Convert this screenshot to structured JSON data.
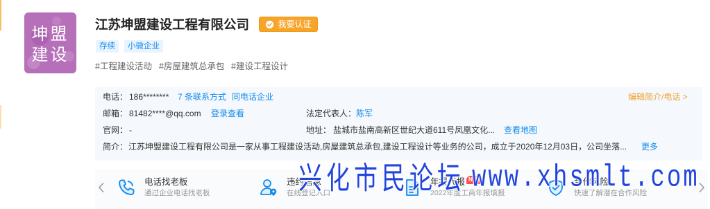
{
  "logo": {
    "line1": "坤盟",
    "line2": "建设",
    "bg_color": "#b66fb9"
  },
  "company": {
    "name": "江苏坤盟建设工程有限公司",
    "verify_badge": {
      "label": "我要认证",
      "icon": "check-circle-icon",
      "color": "#f7a52a"
    },
    "tags": [
      "存续",
      "小微企业"
    ],
    "hashtags": [
      "#工程建设活动",
      "#房屋建筑总承包",
      "#建设工程设计"
    ]
  },
  "info": {
    "edit_link": "编辑简介/电话 >",
    "phone": {
      "label": "电话：",
      "value": "186********",
      "contacts_link": "7 条联系方式",
      "same_phone_link": "同电话企业"
    },
    "email": {
      "label": "邮箱：",
      "value": "81482****@qq.com",
      "login_link": "登录查看"
    },
    "legal_rep": {
      "label": "法定代表人：",
      "value": "陈军"
    },
    "website": {
      "label": "官网：",
      "value": "-"
    },
    "address": {
      "label": "地址：",
      "value": "盐城市盐南高新区世纪大道611号凤凰文化...",
      "map_link": "查看地图"
    },
    "intro": {
      "label": "简介：",
      "value": "江苏坤盟建设工程有限公司是一家从事工程建设活动,房屋建筑总承包,建设工程设计等业务的公司，成立于2020年12月03日，公司坐落...",
      "more_link": "更多"
    }
  },
  "services": {
    "prev_icon": "chevron-left-icon",
    "next_icon": "chevron-right-icon",
    "items": [
      {
        "icon": "phone-icon",
        "title": "电话找老板",
        "subtitle": "通过企业电话找老板"
      },
      {
        "icon": "person-location-icon",
        "title": "违约信息",
        "subtitle": "在线登记入口"
      },
      {
        "icon": "document-icon",
        "title": "年报代报",
        "badge": "NEW",
        "subtitle": "2022年度工商年报填报"
      },
      {
        "icon": "shield-check-icon",
        "title": "合作风险",
        "subtitle": "快速了解潜在合作风险"
      }
    ]
  },
  "watermark": {
    "text_cn": "兴化市民论坛",
    "text_url": "www.xhsmlt.com",
    "color": "#2345dc"
  },
  "colors": {
    "link": "#128bed",
    "accent": "#f0a030",
    "text": "#333333",
    "muted": "#999999",
    "info_box_bg": "#f5f8fc",
    "tag_bg": "#e9f4fe",
    "new_badge": "#ff4d4f"
  }
}
